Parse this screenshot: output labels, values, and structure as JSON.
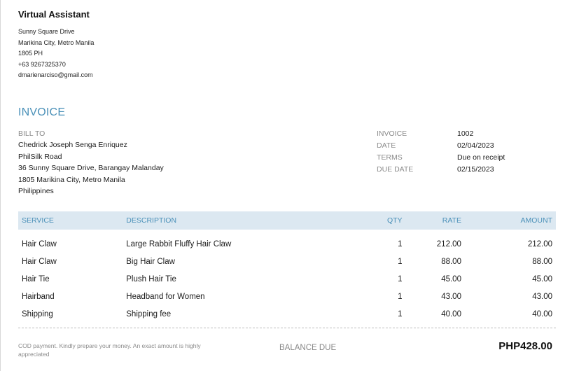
{
  "company": {
    "name": "Virtual Assistant",
    "address_lines": [
      "Sunny Square Drive",
      "Marikina City, Metro Manila",
      "1805 PH",
      "+63 9267325370",
      "dmarienarciso@gmail.com"
    ]
  },
  "invoice": {
    "title": "INVOICE",
    "bill_to_label": "BILL TO",
    "bill_to_lines": [
      "Chedrick Joseph Senga Enriquez",
      "PhilSilk Road",
      "36 Sunny Square Drive, Barangay Malanday",
      "1805 Marikina City, Metro Manila",
      "Philippines"
    ],
    "meta": [
      {
        "label": "INVOICE",
        "value": "1002"
      },
      {
        "label": "DATE",
        "value": "02/04/2023"
      },
      {
        "label": "TERMS",
        "value": "Due on receipt"
      },
      {
        "label": "DUE DATE",
        "value": "02/15/2023"
      }
    ]
  },
  "table": {
    "headers": {
      "service": "SERVICE",
      "description": "DESCRIPTION",
      "qty": "QTY",
      "rate": "RATE",
      "amount": "AMOUNT"
    },
    "rows": [
      {
        "service": "Hair Claw",
        "description": "Large Rabbit Fluffy Hair Claw",
        "qty": "1",
        "rate": "212.00",
        "amount": "212.00"
      },
      {
        "service": "Hair Claw",
        "description": "Big Hair Claw",
        "qty": "1",
        "rate": "88.00",
        "amount": "88.00"
      },
      {
        "service": "Hair Tie",
        "description": "Plush Hair Tie",
        "qty": "1",
        "rate": "45.00",
        "amount": "45.00"
      },
      {
        "service": "Hairband",
        "description": "Headband for Women",
        "qty": "1",
        "rate": "43.00",
        "amount": "43.00"
      },
      {
        "service": "Shipping",
        "description": "Shipping fee",
        "qty": "1",
        "rate": "40.00",
        "amount": "40.00"
      }
    ]
  },
  "footer": {
    "note": "COD payment. Kindly prepare your money. An exact amount is highly appreciated",
    "balance_label": "BALANCE DUE",
    "balance_value": "PHP428.00"
  },
  "colors": {
    "accent": "#4a90b8",
    "header_bg": "#dce8f1",
    "muted": "#8a8a8a"
  }
}
